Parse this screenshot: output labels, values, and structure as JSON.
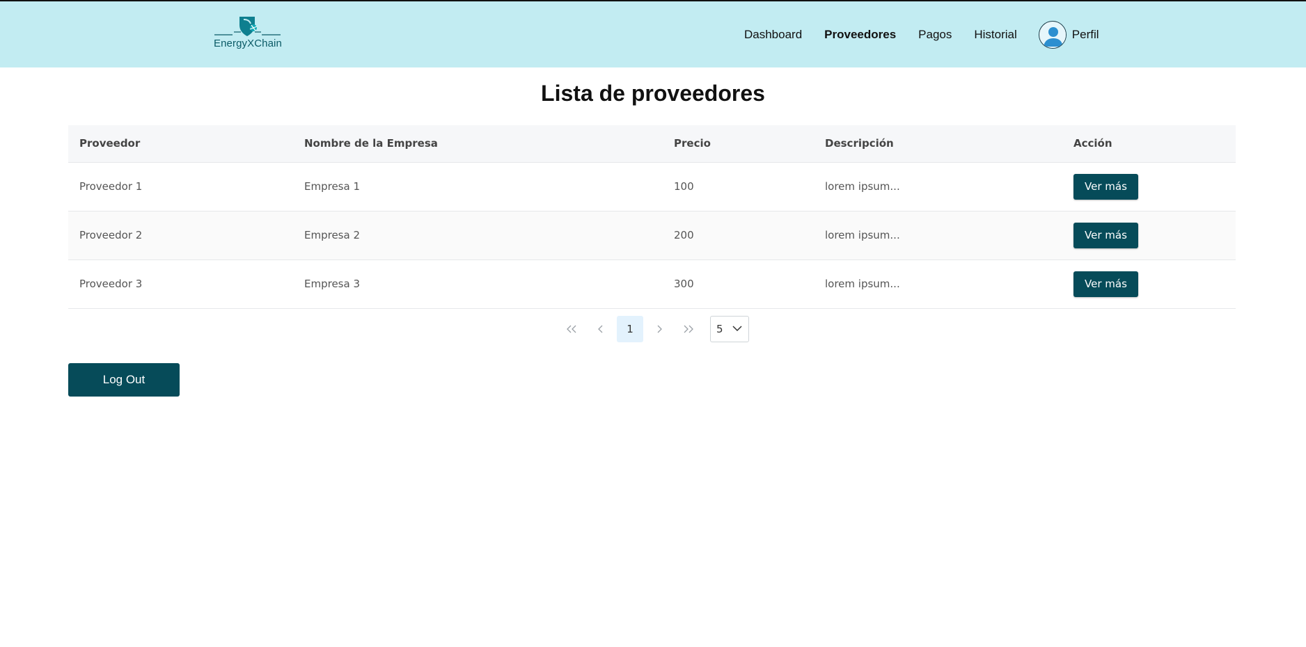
{
  "colors": {
    "navbar_bg": "#c2ecf2",
    "primary": "#064b59",
    "logo": "#0a5a66"
  },
  "brand": {
    "name": "EnergyXChain",
    "icon": "shield-bolt-icon"
  },
  "nav": {
    "items": [
      {
        "label": "Dashboard",
        "active": false
      },
      {
        "label": "Proveedores",
        "active": true
      },
      {
        "label": "Pagos",
        "active": false
      },
      {
        "label": "Historial",
        "active": false
      }
    ],
    "profile": {
      "label": "Perfil",
      "icon": "user-avatar-icon"
    }
  },
  "page": {
    "title": "Lista de proveedores"
  },
  "table": {
    "columns": [
      "Proveedor",
      "Nombre de la Empresa",
      "Precio",
      "Descripción",
      "Acción"
    ],
    "rows": [
      {
        "proveedor": "Proveedor 1",
        "empresa": "Empresa 1",
        "precio": "100",
        "descripcion": "lorem ipsum...",
        "accion": "Ver más"
      },
      {
        "proveedor": "Proveedor 2",
        "empresa": "Empresa 2",
        "precio": "200",
        "descripcion": "lorem ipsum...",
        "accion": "Ver más"
      },
      {
        "proveedor": "Proveedor 3",
        "empresa": "Empresa 3",
        "precio": "300",
        "descripcion": "lorem ipsum...",
        "accion": "Ver más"
      }
    ]
  },
  "pagination": {
    "first_icon": "double-chevron-left-icon",
    "prev_icon": "chevron-left-icon",
    "current_page": "1",
    "next_icon": "chevron-right-icon",
    "last_icon": "double-chevron-right-icon",
    "rows_per_page": "5"
  },
  "actions": {
    "logout_label": "Log Out"
  }
}
